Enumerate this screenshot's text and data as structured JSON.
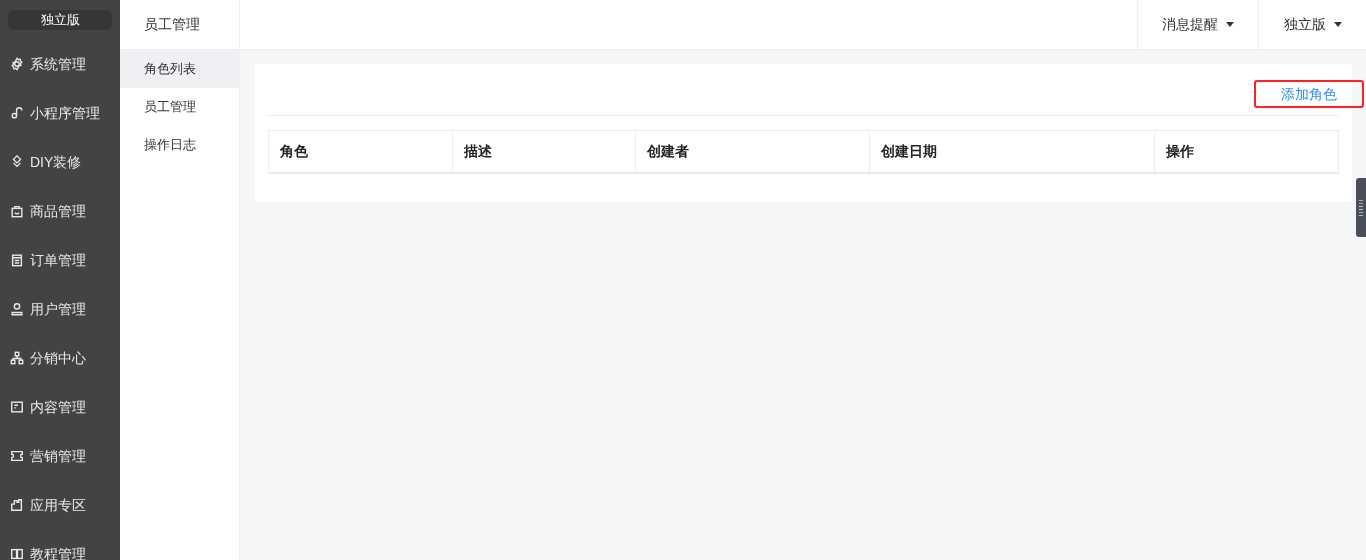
{
  "brand": {
    "label": "独立版"
  },
  "sidebar": {
    "items": [
      {
        "label": "系统管理"
      },
      {
        "label": "小程序管理"
      },
      {
        "label": "DIY装修"
      },
      {
        "label": "商品管理"
      },
      {
        "label": "订单管理"
      },
      {
        "label": "用户管理"
      },
      {
        "label": "分销中心"
      },
      {
        "label": "内容管理"
      },
      {
        "label": "营销管理"
      },
      {
        "label": "应用专区"
      },
      {
        "label": "教程管理"
      }
    ]
  },
  "submenu": {
    "title": "员工管理",
    "items": [
      {
        "label": "角色列表",
        "selected": true
      },
      {
        "label": "员工管理",
        "selected": false
      },
      {
        "label": "操作日志",
        "selected": false
      }
    ]
  },
  "topbar": {
    "menus": [
      "消息提醒",
      "独立版"
    ]
  },
  "card": {
    "action": {
      "label": "添加角色",
      "highlighted": true
    },
    "table": {
      "columns": [
        "角色",
        "描述",
        "创建者",
        "创建日期",
        "操作"
      ]
    }
  }
}
